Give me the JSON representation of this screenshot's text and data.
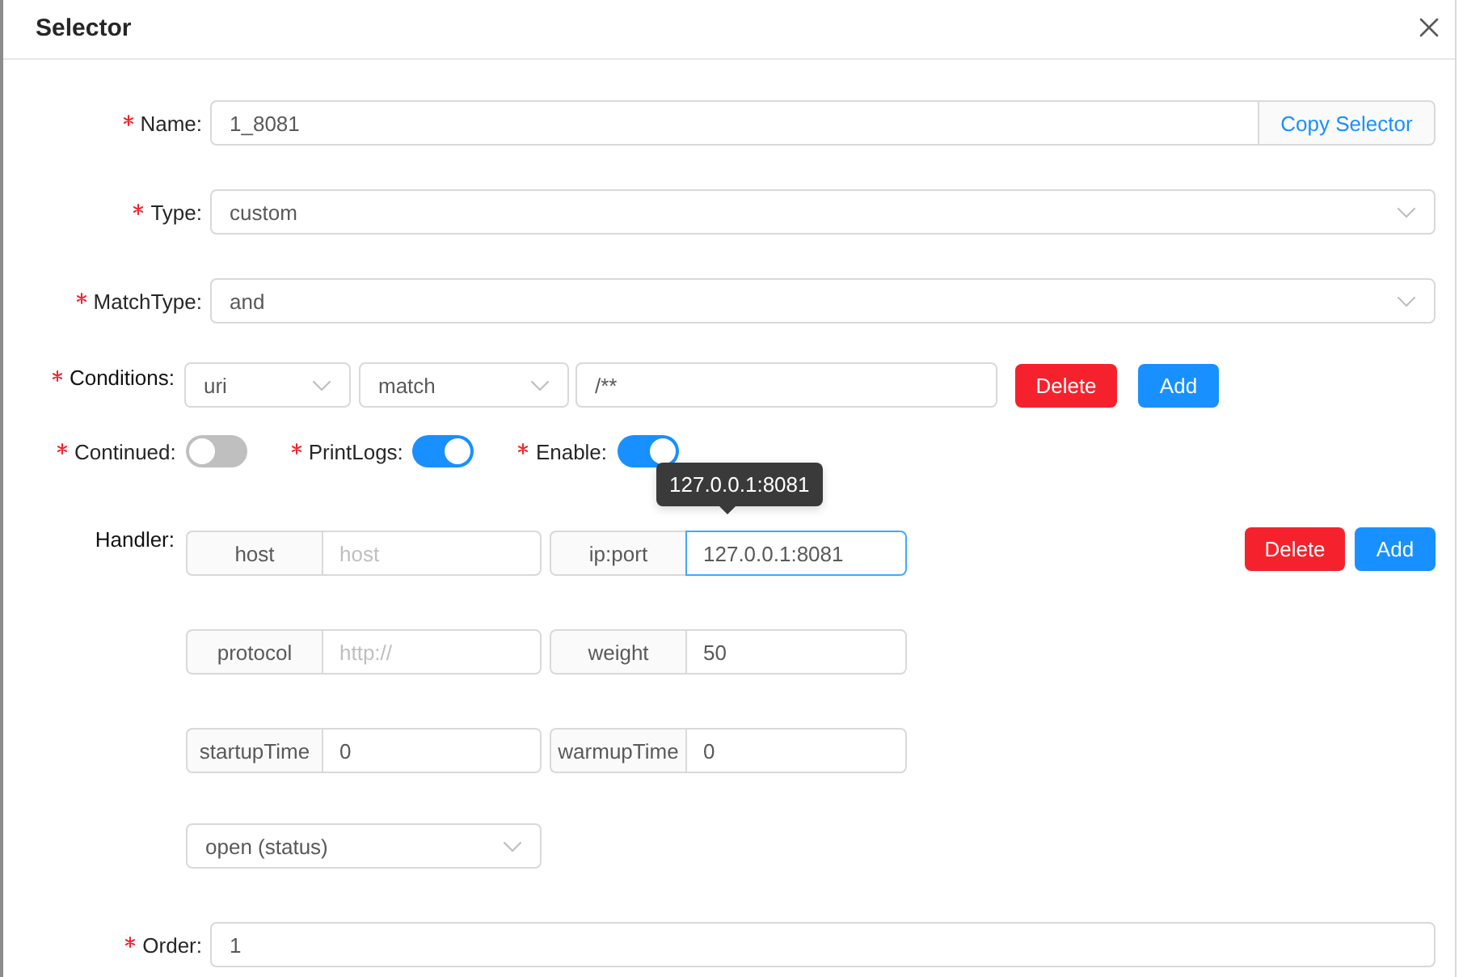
{
  "dialog": {
    "title": "Selector"
  },
  "fields": [
    {
      "kind": "input_addon",
      "label": "Name:",
      "required": true,
      "value": "1_8081",
      "addon": "Copy Selector"
    },
    {
      "kind": "select",
      "label": "Type:",
      "required": true,
      "value": "custom"
    },
    {
      "kind": "select",
      "label": "MatchType:",
      "required": true,
      "value": "and"
    }
  ],
  "conditions": {
    "label": "Conditions:",
    "required": true,
    "param_type": "uri",
    "operator": "match",
    "value": "/**",
    "buttons": [
      {
        "kind": "danger",
        "label": "Delete"
      },
      {
        "kind": "primary",
        "label": "Add"
      }
    ]
  },
  "switches": [
    {
      "label": "Continued:",
      "required": true,
      "on": false
    },
    {
      "label": "PrintLogs:",
      "required": true,
      "on": true
    },
    {
      "label": "Enable:",
      "required": true,
      "on": true
    }
  ],
  "handler": {
    "label": "Handler:",
    "required": false,
    "rows": [
      [
        {
          "addon": "host",
          "placeholder": "host",
          "focused": false
        },
        {
          "addon": "ip:port",
          "value": "127.0.0.1:8081",
          "focused": true,
          "tooltip": "127.0.0.1:8081"
        }
      ],
      [
        {
          "addon": "protocol",
          "placeholder": "http://",
          "focused": false
        },
        {
          "addon": "weight",
          "value": "50",
          "focused": false
        }
      ],
      [
        {
          "addon": "startupTime",
          "value": "0",
          "focused": false
        },
        {
          "addon": "warmupTime",
          "value": "0",
          "focused": false
        }
      ]
    ],
    "status_select": "open (status)",
    "buttons": [
      {
        "kind": "danger",
        "label": "Delete"
      },
      {
        "kind": "primary",
        "label": "Add"
      }
    ]
  },
  "order": {
    "kind": "input",
    "label": "Order:",
    "required": true,
    "value": "1"
  }
}
